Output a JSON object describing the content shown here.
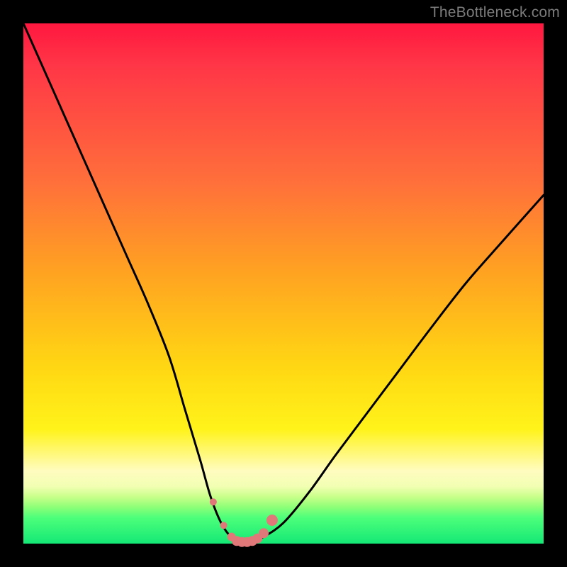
{
  "watermark": "TheBottleneck.com",
  "colors": {
    "frame": "#000000",
    "curve_stroke": "#000000",
    "marker_fill": "#e0787a",
    "marker_stroke": "#cf6264"
  },
  "chart_data": {
    "type": "line",
    "title": "",
    "xlabel": "",
    "ylabel": "",
    "xlim": [
      0,
      100
    ],
    "ylim": [
      0,
      100
    ],
    "grid": false,
    "legend": false,
    "series": [
      {
        "name": "bottleneck-curve",
        "x": [
          0,
          4,
          8,
          12,
          16,
          20,
          24,
          28,
          31,
          34,
          36,
          38,
          40,
          42,
          44,
          46,
          50,
          55,
          60,
          66,
          72,
          78,
          85,
          92,
          100
        ],
        "y": [
          100,
          91,
          82,
          73,
          64,
          55,
          46,
          36,
          26,
          16,
          9,
          4,
          1.2,
          0.3,
          0.3,
          1.2,
          4,
          10,
          17,
          25,
          33,
          41,
          50,
          58,
          67
        ]
      }
    ],
    "markers": {
      "name": "highlight-dots",
      "x": [
        36.5,
        38.5,
        40.0,
        41.0,
        42.0,
        43.0,
        44.0,
        45.0,
        46.2,
        47.8
      ],
      "y": [
        8.0,
        3.5,
        1.3,
        0.5,
        0.3,
        0.3,
        0.5,
        1.0,
        2.0,
        4.5
      ],
      "r": [
        5,
        5,
        6,
        7,
        7,
        7,
        7,
        7,
        7,
        8
      ]
    }
  }
}
